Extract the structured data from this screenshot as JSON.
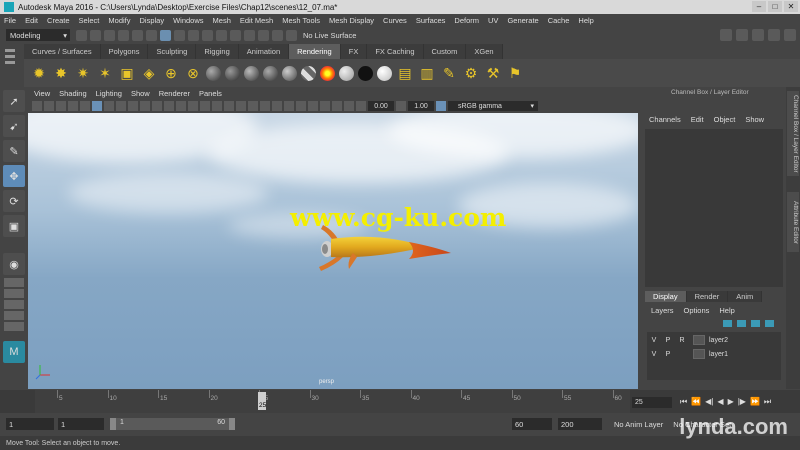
{
  "window": {
    "title": "Autodesk Maya 2016 - C:\\Users\\Lynda\\Desktop\\Exercise Files\\Chap12\\scenes\\12_07.ma*"
  },
  "menubar": [
    "File",
    "Edit",
    "Create",
    "Select",
    "Modify",
    "Display",
    "Windows",
    "Mesh",
    "Edit Mesh",
    "Mesh Tools",
    "Mesh Display",
    "Curves",
    "Surfaces",
    "Deform",
    "UV",
    "Generate",
    "Cache",
    "Help"
  ],
  "statusline": {
    "mode": "Modeling",
    "live_surface": "No Live Surface"
  },
  "shelf": {
    "tabs": [
      "Curves / Surfaces",
      "Polygons",
      "Sculpting",
      "Rigging",
      "Animation",
      "Rendering",
      "FX",
      "FX Caching",
      "Custom",
      "XGen"
    ],
    "active_tab": "Rendering"
  },
  "panel": {
    "menu": [
      "View",
      "Shading",
      "Lighting",
      "Show",
      "Renderer",
      "Panels"
    ],
    "exposure": "0.00",
    "gamma": "1.00",
    "color_space": "sRGB gamma",
    "camera_label": "persp"
  },
  "viewport": {
    "watermark": "www.cg-ku.com"
  },
  "channel_box": {
    "title": "Channel Box / Layer Editor",
    "menu": [
      "Channels",
      "Edit",
      "Object",
      "Show"
    ]
  },
  "layer_editor": {
    "tabs": [
      "Display",
      "Render",
      "Anim"
    ],
    "active_tab": "Display",
    "menu": [
      "Layers",
      "Options",
      "Help"
    ],
    "layers": [
      {
        "v": "V",
        "p": "P",
        "r": "R",
        "name": "layer2"
      },
      {
        "v": "V",
        "p": "P",
        "r": "",
        "name": "layer1"
      }
    ]
  },
  "side_tabs": [
    "Channel Box / Layer Editor",
    "Attribute Editor"
  ],
  "timeline": {
    "ticks": [
      "5",
      "10",
      "15",
      "20",
      "25",
      "30",
      "35",
      "40",
      "45",
      "50",
      "55",
      "60"
    ],
    "current_frame": "25",
    "current_frame_field": "25"
  },
  "range": {
    "start": "1",
    "playback_start": "1",
    "range_start_label": "1",
    "range_end_label": "60",
    "playback_end": "60",
    "end": "200",
    "anim_layer": "No Anim Layer",
    "character_set": "No Character Set"
  },
  "help_line": "Move Tool: Select an object to move.",
  "brand": "lynda.com"
}
